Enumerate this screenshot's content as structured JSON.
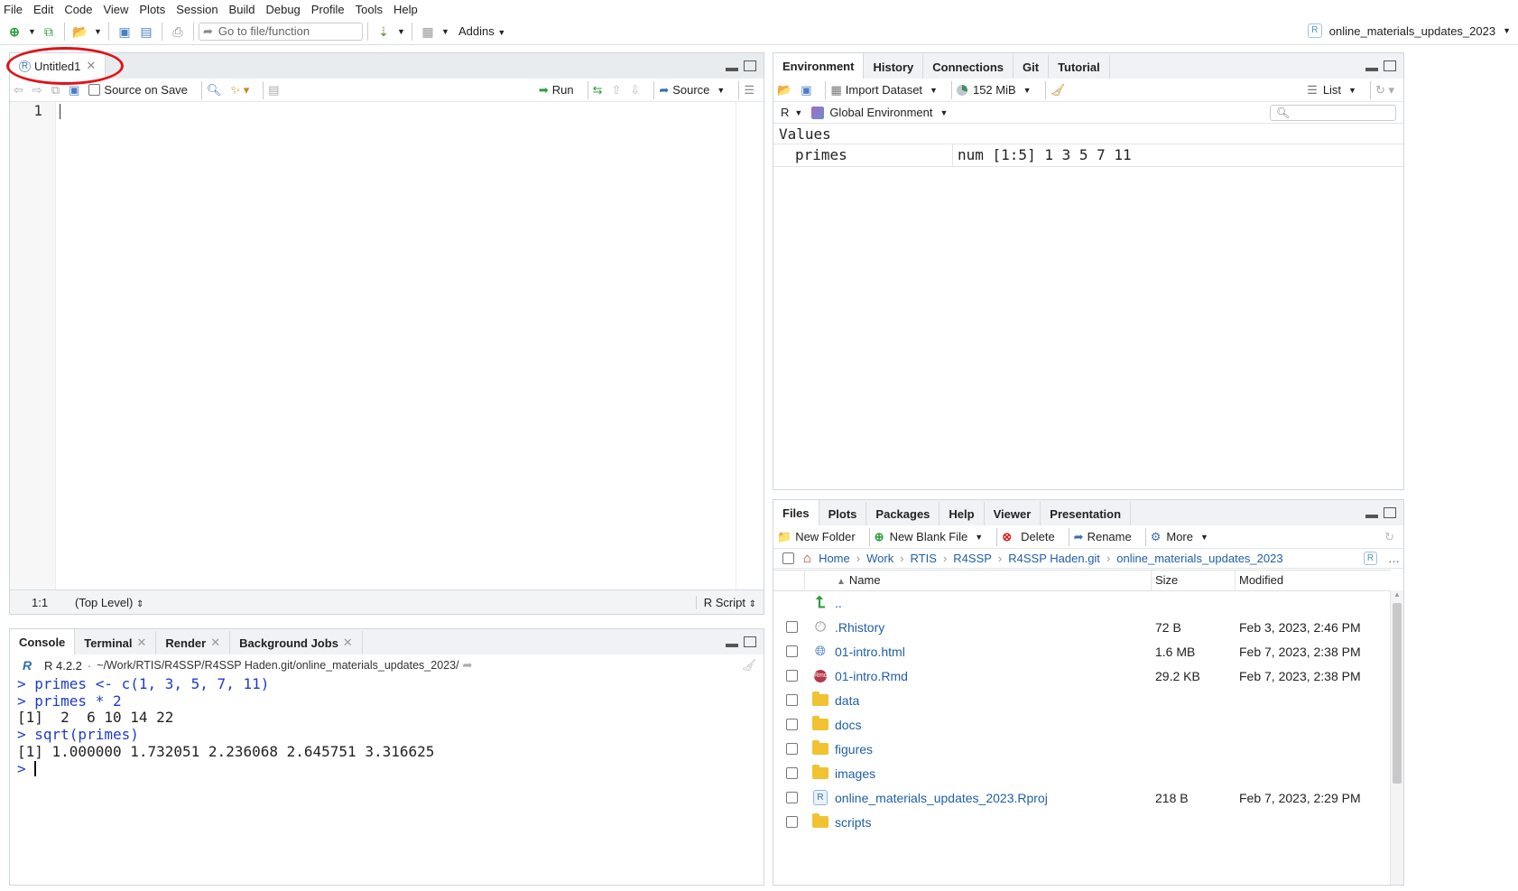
{
  "menu": [
    "File",
    "Edit",
    "Code",
    "View",
    "Plots",
    "Session",
    "Build",
    "Debug",
    "Profile",
    "Tools",
    "Help"
  ],
  "toolbar": {
    "goto_placeholder": "Go to file/function",
    "addins": "Addins",
    "project": "online_materials_updates_2023"
  },
  "editor": {
    "tab_label": "Untitled1",
    "source_on_save": "Source on Save",
    "run": "Run",
    "source": "Source",
    "line_number": "1",
    "status_pos": "1:1",
    "status_scope": "(Top Level)",
    "status_type": "R Script"
  },
  "console": {
    "tabs": [
      "Console",
      "Terminal",
      "Render",
      "Background Jobs"
    ],
    "r_version": "R 4.2.2",
    "path": "~/Work/RTIS/R4SSP/R4SSP Haden.git/online_materials_updates_2023/",
    "lines": [
      {
        "text": "> primes <- c(1, 3, 5, 7, 11)",
        "kind": "input"
      },
      {
        "text": "> primes * 2",
        "kind": "input"
      },
      {
        "text": "[1]  2  6 10 14 22",
        "kind": "output"
      },
      {
        "text": "> sqrt(primes)",
        "kind": "input"
      },
      {
        "text": "[1] 1.000000 1.732051 2.236068 2.645751 3.316625",
        "kind": "output"
      },
      {
        "text": "> ",
        "kind": "input"
      }
    ]
  },
  "environment": {
    "tabs": [
      "Environment",
      "History",
      "Connections",
      "Git",
      "Tutorial"
    ],
    "import_dataset": "Import Dataset",
    "memory": "152 MiB",
    "view_mode": "List",
    "language": "R",
    "scope": "Global Environment",
    "section": "Values",
    "rows": [
      {
        "name": "primes",
        "value": "num [1:5] 1 3 5 7 11"
      }
    ]
  },
  "files": {
    "tabs": [
      "Files",
      "Plots",
      "Packages",
      "Help",
      "Viewer",
      "Presentation"
    ],
    "new_folder": "New Folder",
    "new_blank_file": "New Blank File",
    "delete": "Delete",
    "rename": "Rename",
    "more": "More",
    "breadcrumb": [
      "Home",
      "Work",
      "RTIS",
      "R4SSP",
      "R4SSP Haden.git",
      "online_materials_updates_2023"
    ],
    "col_name": "Name",
    "col_size": "Size",
    "col_modified": "Modified",
    "parent": "..",
    "rows": [
      {
        "name": ".Rhistory",
        "size": "72 B",
        "modified": "Feb 3, 2023, 2:46 PM",
        "icon": "history-icon"
      },
      {
        "name": "01-intro.html",
        "size": "1.6 MB",
        "modified": "Feb 7, 2023, 2:38 PM",
        "icon": "html-icon"
      },
      {
        "name": "01-intro.Rmd",
        "size": "29.2 KB",
        "modified": "Feb 7, 2023, 2:38 PM",
        "icon": "rmd-icon"
      },
      {
        "name": "data",
        "size": "",
        "modified": "",
        "icon": "folder-icon"
      },
      {
        "name": "docs",
        "size": "",
        "modified": "",
        "icon": "folder-icon"
      },
      {
        "name": "figures",
        "size": "",
        "modified": "",
        "icon": "folder-icon"
      },
      {
        "name": "images",
        "size": "",
        "modified": "",
        "icon": "folder-icon"
      },
      {
        "name": "online_materials_updates_2023.Rproj",
        "size": "218 B",
        "modified": "Feb 7, 2023, 2:29 PM",
        "icon": "rproj-icon"
      },
      {
        "name": "scripts",
        "size": "",
        "modified": "",
        "icon": "folder-icon"
      }
    ]
  },
  "colors": {
    "accent": "#1e3cc8",
    "highlight": "#e0131a",
    "link": "#1f5fa8"
  }
}
